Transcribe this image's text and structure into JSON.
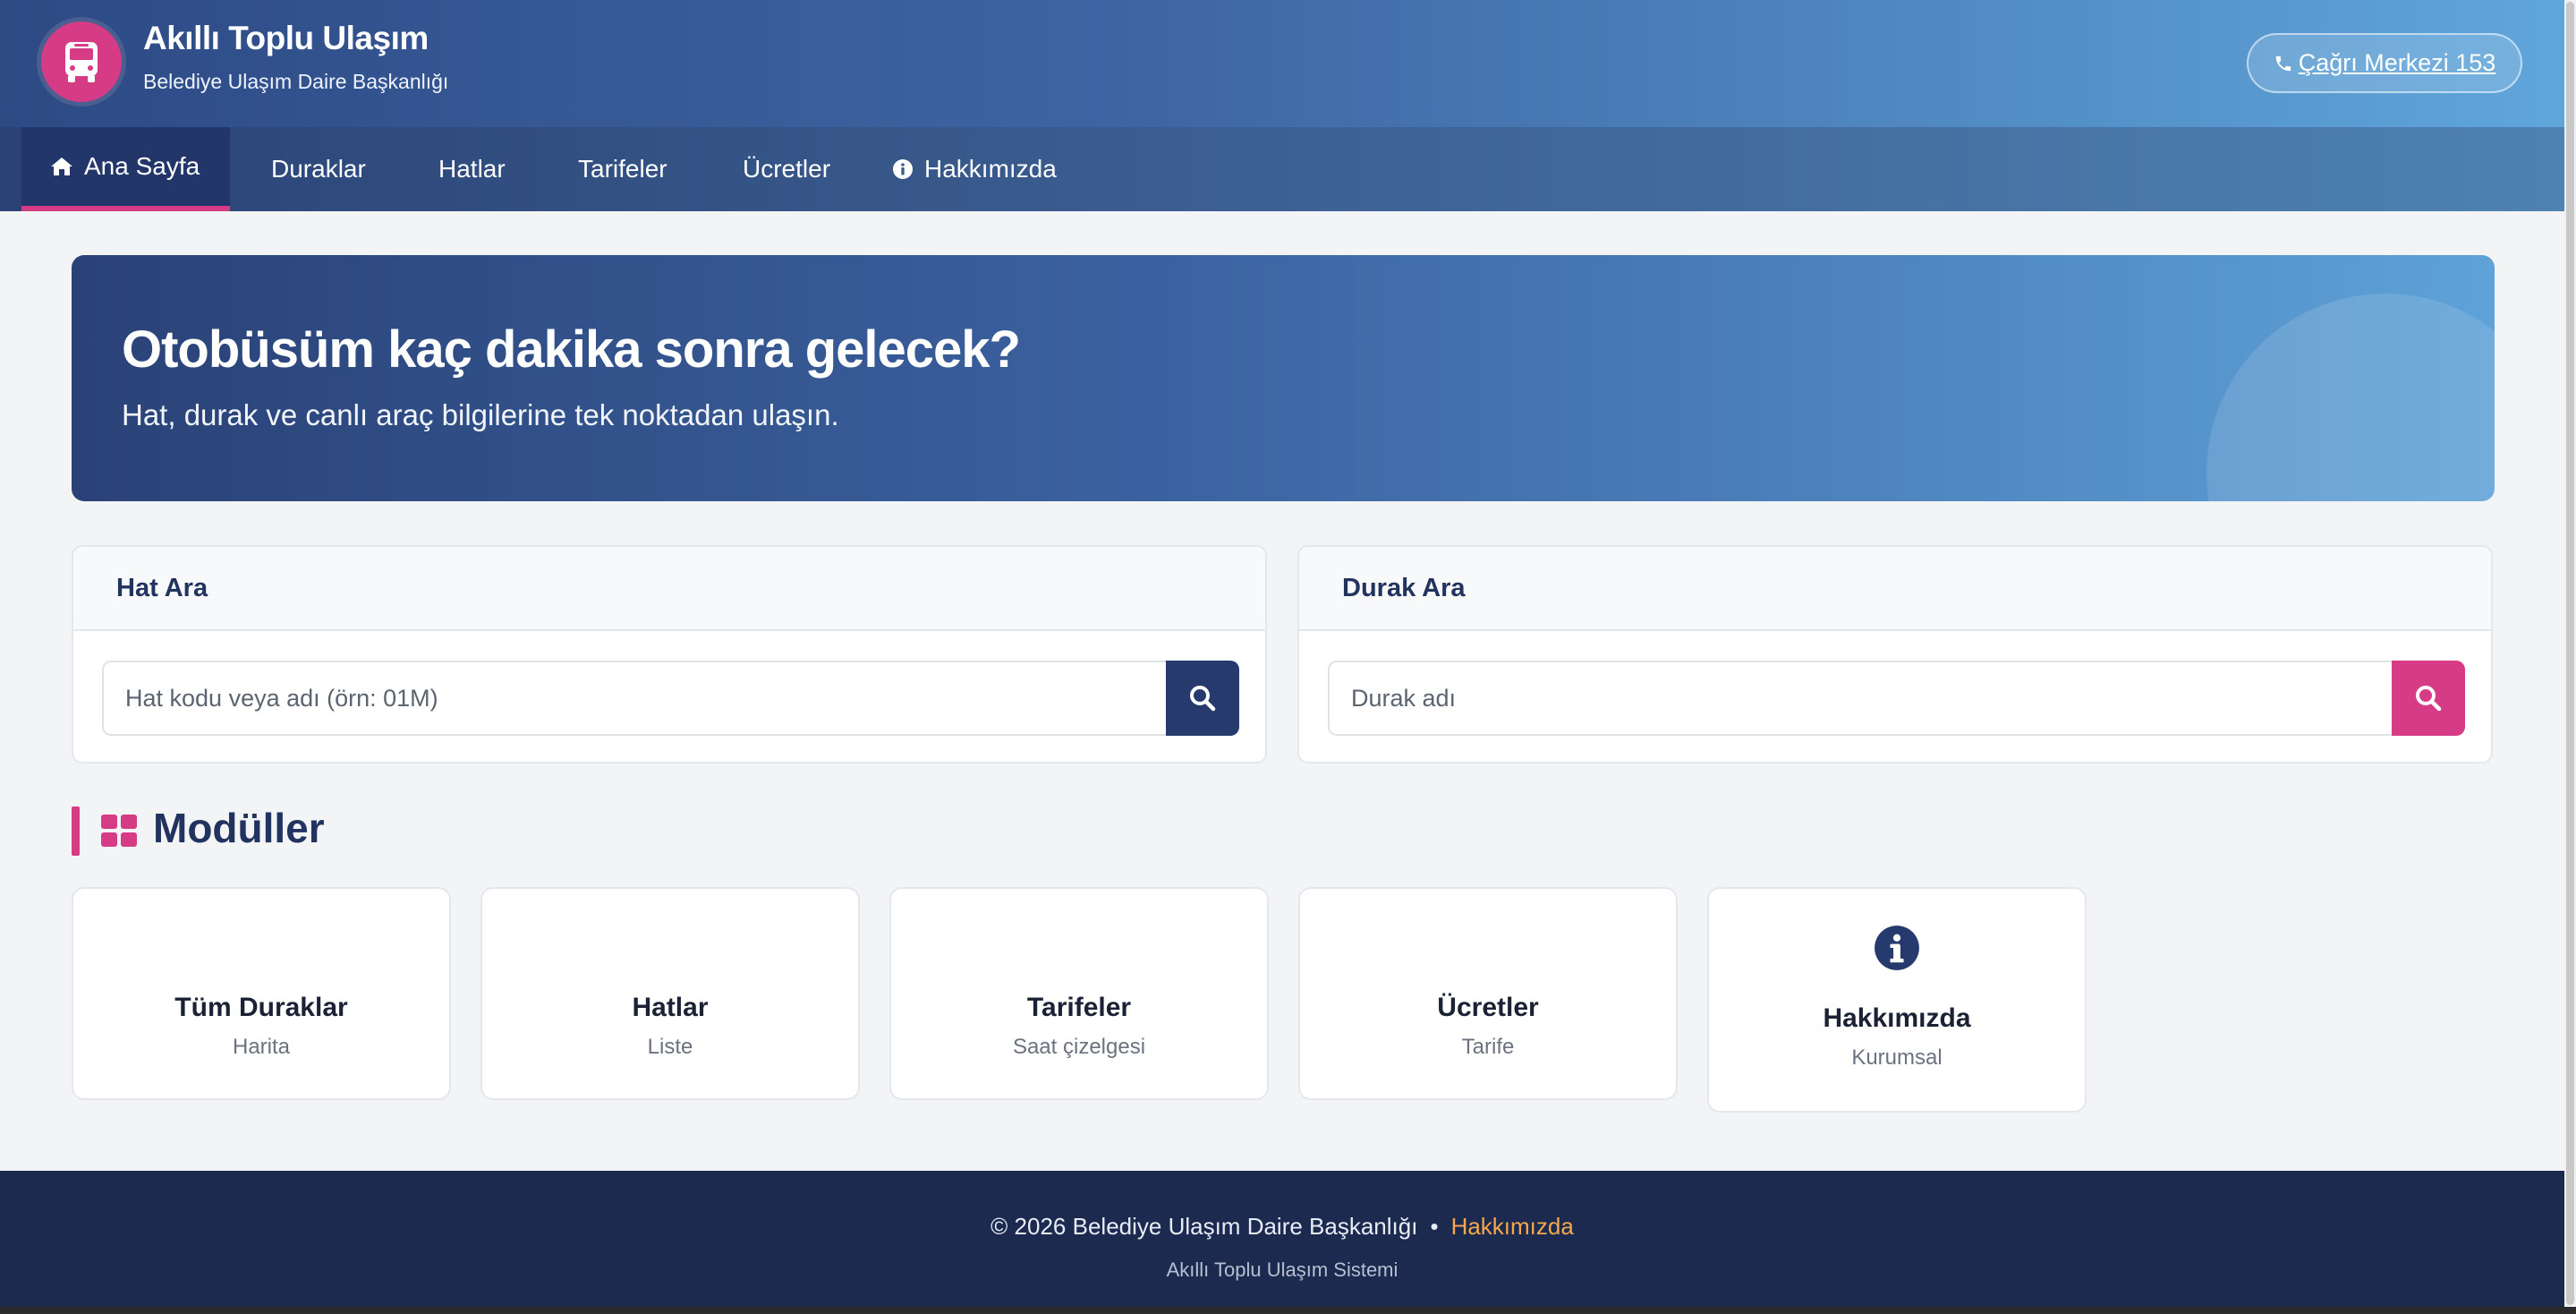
{
  "header": {
    "title": "Akıllı Toplu Ulaşım",
    "subtitle": "Belediye Ulaşım Daire Başkanlığı",
    "call_center": "Çağrı Merkezi 153",
    "logo_icon": "bus-icon"
  },
  "nav": {
    "items": [
      {
        "label": "Ana Sayfa",
        "icon": "home-icon",
        "active": true
      },
      {
        "label": "Duraklar"
      },
      {
        "label": "Hatlar"
      },
      {
        "label": "Tarifeler"
      },
      {
        "label": "Ücretler"
      },
      {
        "label": "Hakkımızda",
        "icon": "info-icon"
      }
    ]
  },
  "hero": {
    "title": "Otobüsüm kaç dakika sonra gelecek?",
    "subtitle": "Hat, durak ve canlı araç bilgilerine tek noktadan ulaşın."
  },
  "search": {
    "line": {
      "title": "Hat Ara",
      "placeholder": "Hat kodu veya adı (örn: 01M)",
      "button_color": "#263a6e"
    },
    "stop": {
      "title": "Durak Ara",
      "placeholder": "Durak adı",
      "button_color": "#d63b86"
    }
  },
  "modules": {
    "title": "Modüller",
    "items": [
      {
        "title": "Tüm Duraklar",
        "subtitle": "Harita"
      },
      {
        "title": "Hatlar",
        "subtitle": "Liste"
      },
      {
        "title": "Tarifeler",
        "subtitle": "Saat çizelgesi"
      },
      {
        "title": "Ücretler",
        "subtitle": "Tarife"
      },
      {
        "title": "Hakkımızda",
        "subtitle": "Kurumsal",
        "icon": "info-icon"
      }
    ]
  },
  "footer": {
    "copyright": "© 2026 Belediye Ulaşım Daire Başkanlığı",
    "separator": "•",
    "link": "Hakkımızda",
    "tagline": "Akıllı Toplu Ulaşım Sistemi"
  },
  "colors": {
    "accent": "#d63b86",
    "primary": "#263a6e",
    "footer_bg": "#1d2a4f",
    "footer_link": "#f4a84b"
  }
}
